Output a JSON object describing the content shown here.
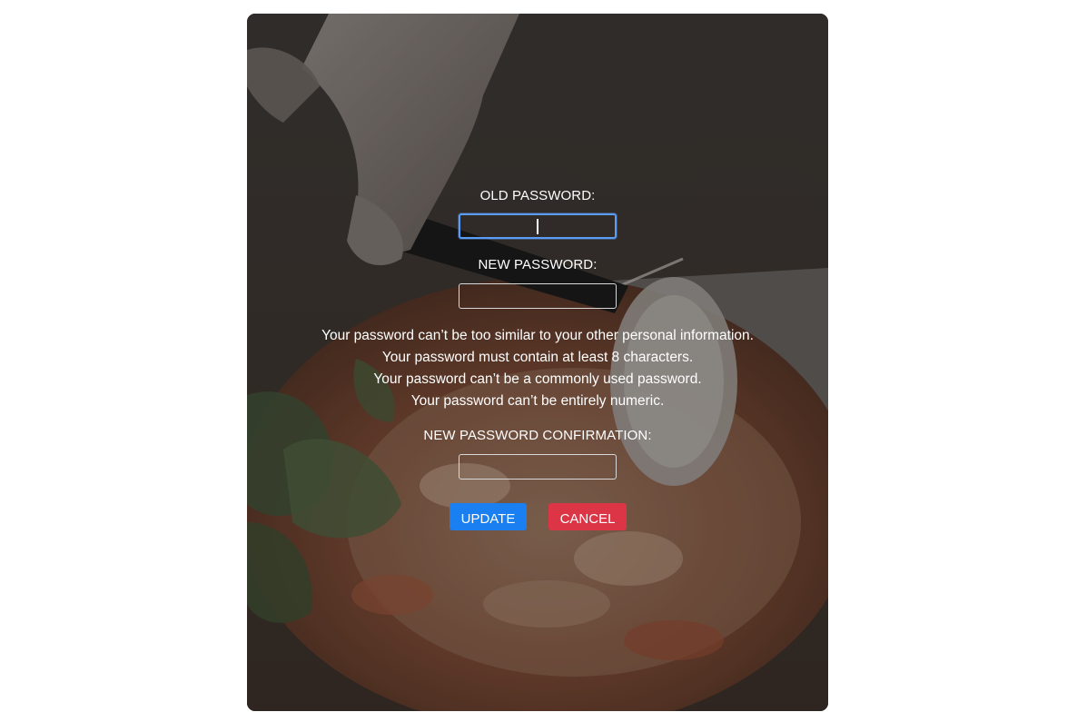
{
  "form": {
    "old_password_label": "OLD PASSWORD:",
    "new_password_label": "NEW PASSWORD:",
    "confirmation_label": "NEW PASSWORD CONFIRMATION:",
    "old_password_value": "",
    "new_password_value": "",
    "confirmation_value": "",
    "help_text": [
      "Your password can’t be too similar to your other personal information.",
      "Your password must contain at least 8 characters.",
      "Your password can’t be a commonly used password.",
      "Your password can’t be entirely numeric."
    ],
    "update_label": "UPDATE",
    "cancel_label": "CANCEL"
  },
  "colors": {
    "update_button": "#1a7ff0",
    "cancel_button": "#dc3545",
    "focus_ring": "#5b9cf5"
  }
}
